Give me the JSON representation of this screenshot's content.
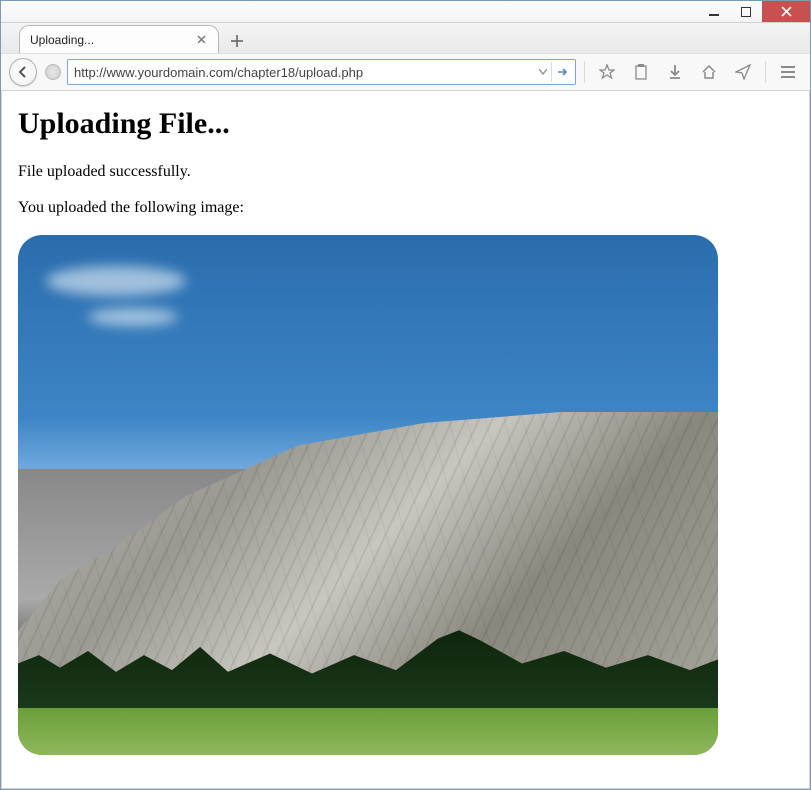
{
  "window": {
    "tab_title": "Uploading...",
    "url": "http://www.yourdomain.com/chapter18/upload.php"
  },
  "icons": {
    "minimize": "minimize-icon",
    "maximize": "maximize-icon",
    "close": "close-icon",
    "tab_close": "close-icon",
    "new_tab": "plus-icon",
    "back": "back-arrow-icon",
    "globe": "globe-icon",
    "dropdown": "chevron-down-icon",
    "go": "arrow-right-icon",
    "star": "star-icon",
    "clipboard": "clipboard-icon",
    "download": "download-arrow-icon",
    "home": "home-icon",
    "send": "paper-plane-icon",
    "menu": "menu-icon"
  },
  "page": {
    "heading": "Uploading File...",
    "status": "File uploaded successfully.",
    "caption": "You uploaded the following image:",
    "image_alt": "Uploaded landscape photo of a granite mountain cliff with trees and meadow"
  }
}
